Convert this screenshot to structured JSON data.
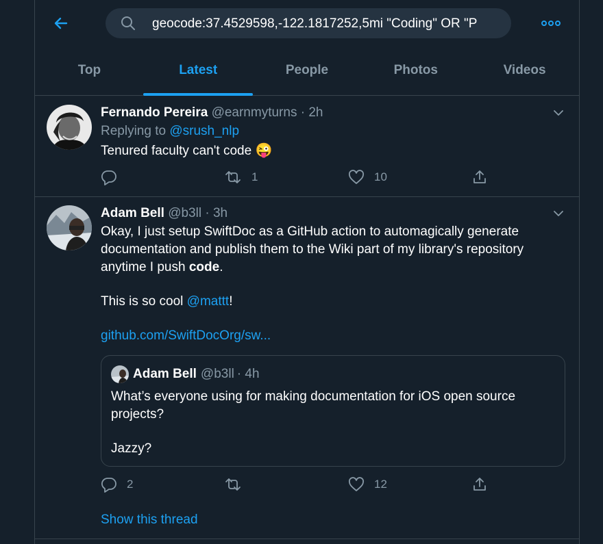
{
  "search": {
    "query": "geocode:37.4529598,-122.1817252,5mi \"Coding\" OR \"P"
  },
  "tabs": [
    {
      "label": "Top"
    },
    {
      "label": "Latest"
    },
    {
      "label": "People"
    },
    {
      "label": "Photos"
    },
    {
      "label": "Videos"
    }
  ],
  "active_tab": "Latest",
  "icons": [
    "back-arrow-icon",
    "search-icon",
    "more-icon",
    "chevron-down-icon",
    "reply-icon",
    "retweet-icon",
    "like-icon",
    "share-icon"
  ],
  "colors": {
    "background": "#15202b",
    "accent": "#1da1f2",
    "muted": "#8899a6",
    "border": "#38444d"
  },
  "tweets": [
    {
      "name": "Fernando Pereira",
      "handle": "@earnmyturns",
      "time": "· 2h",
      "replying_prefix": "Replying to",
      "replying_to": "@srush_nlp",
      "text": "Tenured faculty can't code",
      "emoji": "😜",
      "replies": "",
      "retweets": "1",
      "likes": "10"
    },
    {
      "name": "Adam Bell",
      "handle": "@b3ll",
      "time": "· 3h",
      "text_line1": "Okay, I just setup SwiftDoc as a GitHub action to automagically generate",
      "text_line2": "documentation and publish them to the Wiki part of my library's repository",
      "text_line3_pre": "anytime I push ",
      "text_line3_bold": "code",
      "text_line3_post": ".",
      "text_p2_pre": "This is so cool ",
      "text_p2_mention": "@mattt",
      "text_p2_post": "!",
      "url": "github.com/SwiftDocOrg/sw...",
      "quote": {
        "name": "Adam Bell",
        "handle": "@b3ll",
        "time": "· 4h",
        "line1": "What’s everyone using for making documentation for iOS open source",
        "line2": "projects?",
        "line3": "Jazzy?"
      },
      "replies": "2",
      "retweets": "",
      "likes": "12",
      "show_thread": "Show this thread"
    }
  ]
}
